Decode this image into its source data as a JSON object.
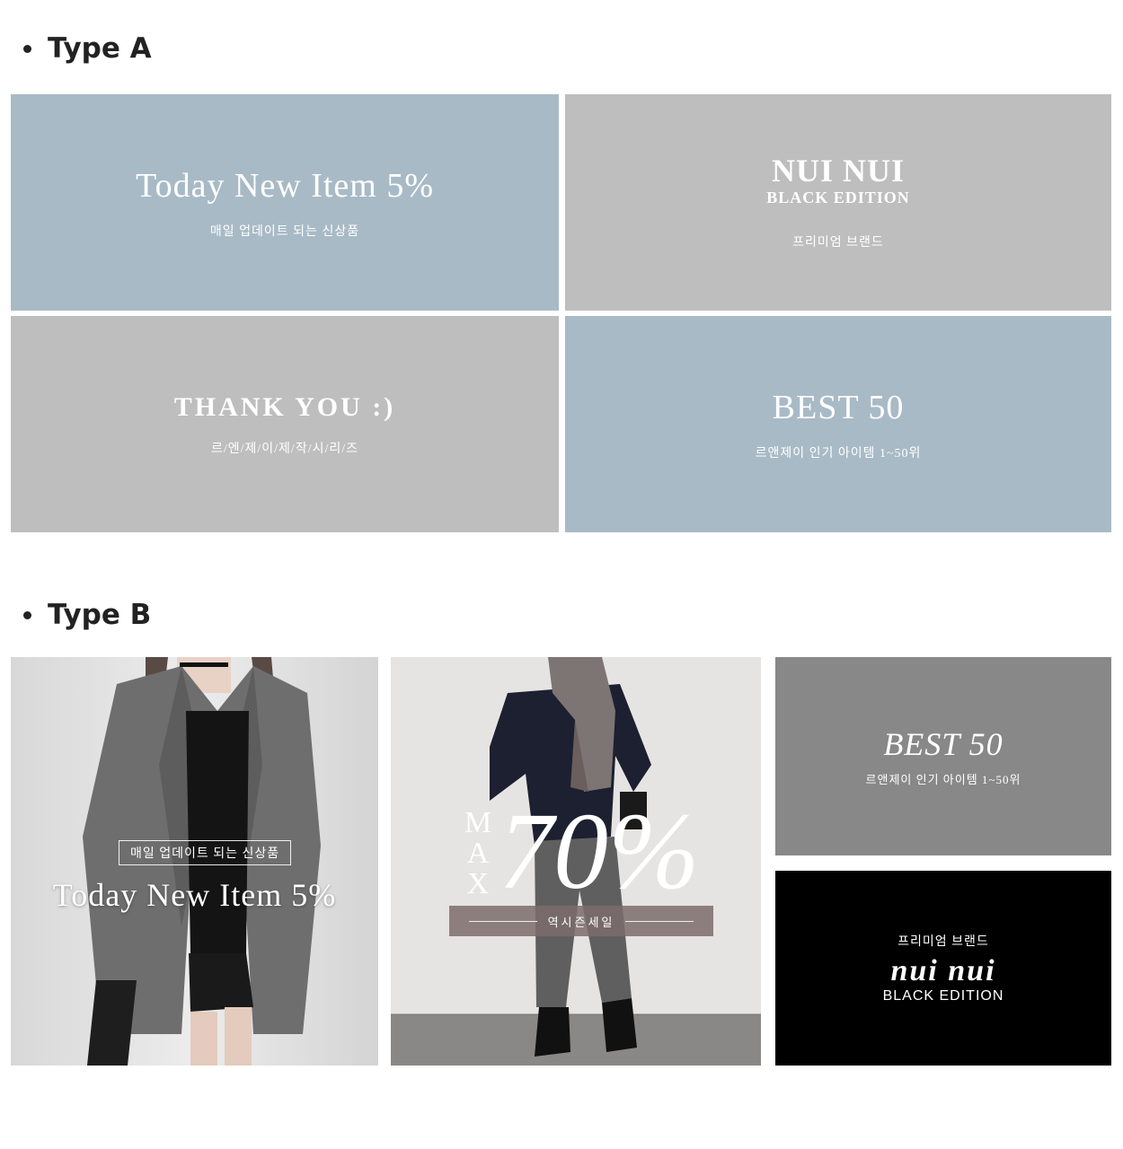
{
  "sections": {
    "a": {
      "title": "Type A"
    },
    "b": {
      "title": "Type B"
    }
  },
  "colors": {
    "blue_tile": "#a8bac6",
    "grey_tile": "#bebebe",
    "dark_grey_tile": "#888888",
    "black_tile": "#000000"
  },
  "type_a": {
    "today": {
      "title": "Today New Item 5%",
      "subtitle": "매일 업데이트 되는 신상품"
    },
    "nui": {
      "title": "NUI NUI",
      "edition": "BLACK EDITION",
      "subtitle": "프리미엄 브랜드"
    },
    "thank": {
      "title": "THANK YOU :)",
      "subtitle": "르/엔/제/이/제/작/시/리/즈"
    },
    "best": {
      "title": "BEST 50",
      "subtitle": "르앤제이 인기 아이템 1~50위"
    }
  },
  "type_b": {
    "today": {
      "box_label": "매일 업데이트 되는 신상품",
      "title": "Today New Item 5%",
      "photo_icon": "model-jacket-photo"
    },
    "sale": {
      "max": "M A X",
      "percent": "70%",
      "band": "역시즌세일",
      "photo_icon": "model-scarf-photo"
    },
    "best": {
      "title": "BEST 50",
      "subtitle": "르앤제이 인기 아이템 1~50위"
    },
    "nui": {
      "top": "프리미엄 브랜드",
      "script": "nui nui",
      "edition": "BLACK EDITION"
    }
  }
}
